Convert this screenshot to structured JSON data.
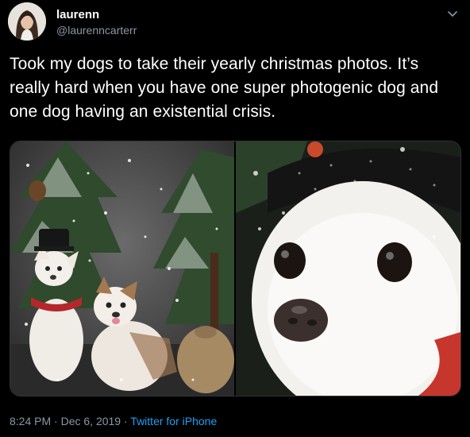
{
  "user": {
    "name": "laurenn",
    "handle": "@laurenncarterr"
  },
  "tweet": {
    "text": "Took my dogs to take their yearly christmas photos. It’s really hard when you have one super photogenic dog and one dog having an existential crisis.",
    "time": "8:24 PM",
    "date": "Dec 6, 2019",
    "separator": "·",
    "source": "Twitter for iPhone"
  },
  "icons": {
    "menu": "chevron-down-icon"
  },
  "colors": {
    "background": "#000000",
    "secondary_text": "#8899a6",
    "link": "#1da1f2"
  }
}
